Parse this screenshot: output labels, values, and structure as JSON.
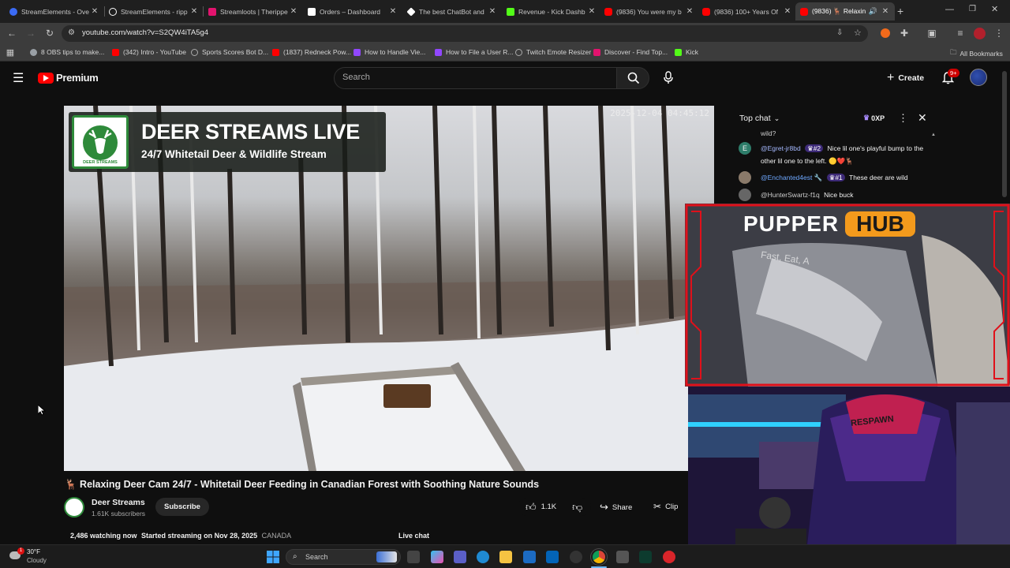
{
  "browser": {
    "tabs": [
      {
        "title": "StreamElements - Ove",
        "color": "#3b6bf5"
      },
      {
        "title": "StreamElements - ripp",
        "color": "#ffffff"
      },
      {
        "title": "Streamloots | Therippe",
        "color": "#e2136e"
      },
      {
        "title": "Orders – Dashboard",
        "color": "#ffffff"
      },
      {
        "title": "The best ChatBot and",
        "color": "#ffffff"
      },
      {
        "title": "Revenue - Kick Dashb",
        "color": "#53fc18"
      },
      {
        "title": "(9836) You were my b",
        "color": "#ff0000"
      },
      {
        "title": "(9836) 100+ Years Of",
        "color": "#ff0000"
      },
      {
        "title": "(9836) 🦌 Relaxin",
        "color": "#ff0000"
      }
    ],
    "url": "youtube.com/watch?v=S2QW4iTA5g4",
    "bookmarks": [
      {
        "label": "8 OBS tips to make...",
        "color": "#9aa0a6"
      },
      {
        "label": "(342) Intro - YouTube",
        "color": "#ff0000"
      },
      {
        "label": "Sports Scores Bot D...",
        "color": "#9aa0a6"
      },
      {
        "label": "(1837) Redneck Pow...",
        "color": "#ff0000"
      },
      {
        "label": "How to Handle Vie...",
        "color": "#9147ff"
      },
      {
        "label": "How to File a User R...",
        "color": "#9147ff"
      },
      {
        "label": "Twitch Emote Resizer",
        "color": "#9aa0a6"
      },
      {
        "label": "Discover - Find Top...",
        "color": "#e2136e"
      },
      {
        "label": "Kick",
        "color": "#53fc18"
      }
    ],
    "all_bookmarks": "All Bookmarks"
  },
  "youtube": {
    "logo_text": "Premium",
    "search_placeholder": "Search",
    "create_label": "Create",
    "notifications_badge": "9+"
  },
  "video": {
    "overlay_title": "DEER STREAMS LIVE",
    "overlay_subtitle": "24/7 Whitetail Deer & Wildlife Stream",
    "logo_text": "DEER STREAMS",
    "timestamp": "2025-12-04 04:45:12"
  },
  "video_info": {
    "title": "🦌 Relaxing Deer Cam 24/7 - Whitetail Deer Feeding in Canadian Forest with Soothing Nature Sounds",
    "channel": "Deer Streams",
    "subscribers": "1.61K subscribers",
    "subscribe_label": "Subscribe",
    "likes": "1.1K",
    "share_label": "Share",
    "clip_label": "Clip",
    "watching": "2,486 watching now",
    "started": "Started streaming on Nov 28, 2025",
    "tag": "CANADA",
    "live_chat_label": "Live chat"
  },
  "chat": {
    "header": "Top chat",
    "xp": "0XP",
    "cut_text": "wild?",
    "messages": [
      {
        "user": "@Egret-jr8bd",
        "badge": "#2",
        "text": "Nice lil one's playful bump to the other lil one to the left.",
        "avatar": "E",
        "avatar_color": "#2e7d6a"
      },
      {
        "user": "@Enchanted4est",
        "badge": "#1",
        "text": "These deer are wild",
        "avatar": "",
        "avatar_color": "#8a7a6a"
      },
      {
        "user": "@HunterSwartz-f1q",
        "badge": "",
        "text": "Nice buck",
        "avatar": "",
        "avatar_color": "#666666"
      }
    ]
  },
  "overlay": {
    "brand_left": "PUPPER",
    "brand_right": "HUB",
    "shirt_text": "Fast, Eat, A",
    "respawn_text": "RESPAWN"
  },
  "taskbar": {
    "weather_temp": "30°F",
    "weather_desc": "Cloudy",
    "weather_badge": "1",
    "search_placeholder": "Search"
  }
}
